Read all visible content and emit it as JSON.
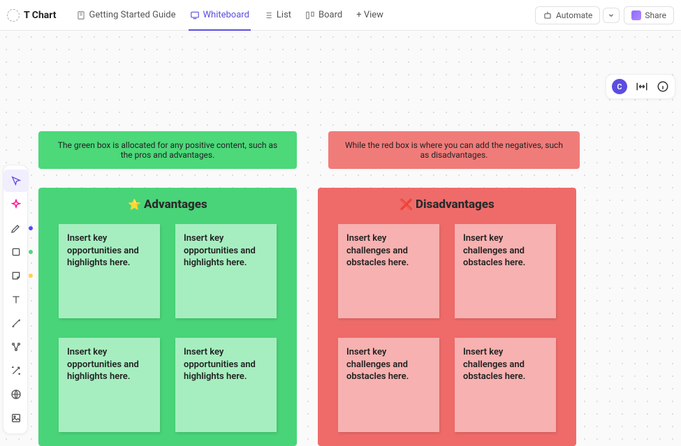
{
  "header": {
    "title": "T Chart",
    "tabs": [
      {
        "label": "Getting Started Guide"
      },
      {
        "label": "Whiteboard"
      },
      {
        "label": "List"
      },
      {
        "label": "Board"
      }
    ],
    "addView": "+ View",
    "automate": "Automate",
    "share": "Share"
  },
  "floating": {
    "avatarInitial": "C"
  },
  "banners": {
    "positive": "The green box is allocated for any positive content, such as the pros and advantages.",
    "negative": "While the red box is where you can add the negatives, such as disadvantages."
  },
  "panels": {
    "advantages": {
      "emoji": "⭐",
      "title": "Advantages",
      "notes": [
        "Insert key opportunities and highlights here.",
        "Insert key opportunities and highlights here.",
        "Insert key opportunities and highlights here.",
        "Insert key opportunities and highlights here."
      ]
    },
    "disadvantages": {
      "emoji": "❌",
      "title": "Disadvantages",
      "notes": [
        "Insert key challenges and obstacles here.",
        "Insert key challenges and obstacles here.",
        "Insert key challenges and obstacles here.",
        "Insert key challenges and obstacles here."
      ]
    }
  }
}
